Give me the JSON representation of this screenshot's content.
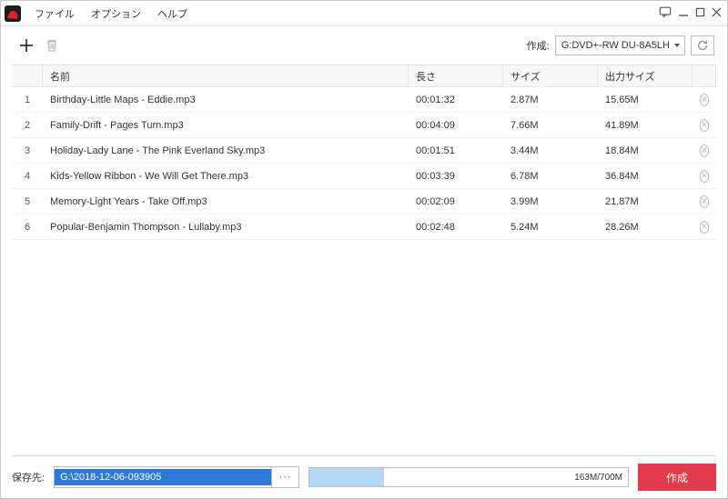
{
  "menu": {
    "file": "ファイル",
    "options": "オプション",
    "help": "ヘルプ"
  },
  "toolbar": {
    "create_label": "作成:",
    "drive": "G:DVD+-RW DU-8A5LH"
  },
  "columns": {
    "name": "名前",
    "length": "長さ",
    "size": "サイズ",
    "output_size": "出力サイズ"
  },
  "rows": [
    {
      "idx": "1",
      "name": "Birthday-Little Maps - Eddie.mp3",
      "length": "00:01:32",
      "size": "2.87M",
      "out": "15.65M"
    },
    {
      "idx": "2",
      "name": "Family-Drift - Pages Turn.mp3",
      "length": "00:04:09",
      "size": "7.66M",
      "out": "41.89M"
    },
    {
      "idx": "3",
      "name": "Holiday-Lady Lane - The Pink Everland Sky.mp3",
      "length": "00:01:51",
      "size": "3.44M",
      "out": "18.84M"
    },
    {
      "idx": "4",
      "name": "Kids-Yellow Ribbon - We Will Get There.mp3",
      "length": "00:03:39",
      "size": "6.78M",
      "out": "36.84M"
    },
    {
      "idx": "5",
      "name": "Memory-Light Years - Take Off.mp3",
      "length": "00:02:09",
      "size": "3.99M",
      "out": "21.87M"
    },
    {
      "idx": "6",
      "name": "Popular-Benjamin Thompson - Lullaby.mp3",
      "length": "00:02:48",
      "size": "5.24M",
      "out": "28.26M"
    }
  ],
  "footer": {
    "save_to_label": "保存先:",
    "save_path": "G:\\2018-12-06-093905",
    "progress_text": "163M/700M",
    "progress_pct": 23.3,
    "create_button": "作成"
  }
}
